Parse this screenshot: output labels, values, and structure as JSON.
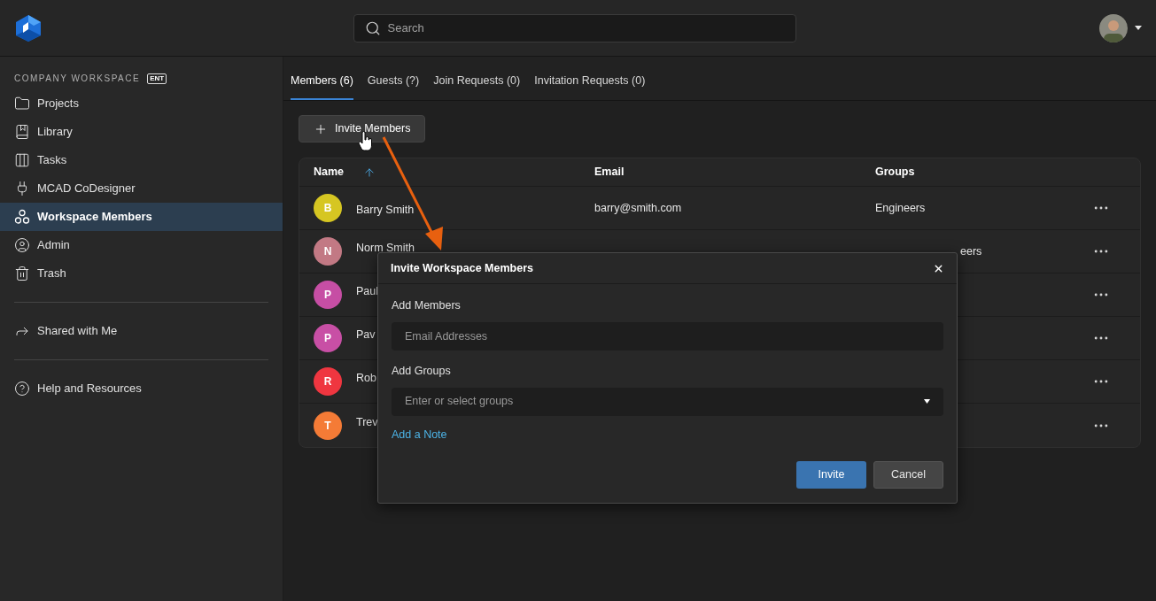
{
  "header": {
    "search": {
      "placeholder": "Search"
    }
  },
  "sidebar": {
    "workspace": "COMPANY WORKSPACE",
    "badge": "ENT",
    "sections": [
      [
        {
          "label": "Projects",
          "selected": false
        },
        {
          "label": "Library",
          "selected": false
        },
        {
          "label": "Tasks",
          "selected": false
        },
        {
          "label": "MCAD CoDesigner",
          "selected": false
        },
        {
          "label": "Workspace Members",
          "selected": true
        },
        {
          "label": "Admin",
          "selected": false
        },
        {
          "label": "Trash",
          "selected": false
        }
      ],
      [
        {
          "label": "Shared with Me",
          "selected": false
        }
      ],
      [
        {
          "label": "Help and Resources",
          "selected": false
        }
      ]
    ]
  },
  "tabs": [
    {
      "label": "Members",
      "count": "(6)",
      "selected": true
    },
    {
      "label": "Guests",
      "count": "(?)",
      "selected": false
    },
    {
      "label": "Join Requests",
      "count": "(0)",
      "selected": false
    },
    {
      "label": "Invitation Requests",
      "count": "(0)",
      "selected": false
    }
  ],
  "invite_button": "Invite Members",
  "table": {
    "columns": [
      {
        "label": "Name",
        "sorted": true
      },
      {
        "label": "Email",
        "sorted": false
      },
      {
        "label": "Groups",
        "sorted": false
      }
    ],
    "rows": [
      {
        "kind": "full",
        "initial": "B",
        "color": "#d6c622",
        "name": "Barry Smith",
        "email": "barry@smith.com",
        "groups": "Engineers"
      },
      {
        "kind": "covered",
        "initial": "N",
        "color": "#c27984",
        "name": "Norm Smith",
        "groups": "eers"
      },
      {
        "kind": "covered",
        "initial": "P",
        "color": "#c64ea4",
        "name": "Paul"
      },
      {
        "kind": "covered",
        "initial": "P",
        "color": "#c84fa5",
        "name": "Pav"
      },
      {
        "kind": "covered",
        "initial": "R",
        "color": "#ef3640",
        "name": "Rob"
      },
      {
        "kind": "covered",
        "initial": "T",
        "color": "#f47b36",
        "name": "Trev"
      }
    ]
  },
  "dialog": {
    "title": "Invite Workspace Members",
    "fields": [
      {
        "kind": "text",
        "label": "Add Members",
        "placeholder": "Email Addresses"
      },
      {
        "kind": "select",
        "label": "Add Groups",
        "placeholder": "Enter or select groups"
      }
    ],
    "link": "Add a Note",
    "buttons": [
      {
        "kind": "primary",
        "label": "Invite"
      },
      {
        "kind": "secondary",
        "label": "Cancel"
      }
    ]
  }
}
